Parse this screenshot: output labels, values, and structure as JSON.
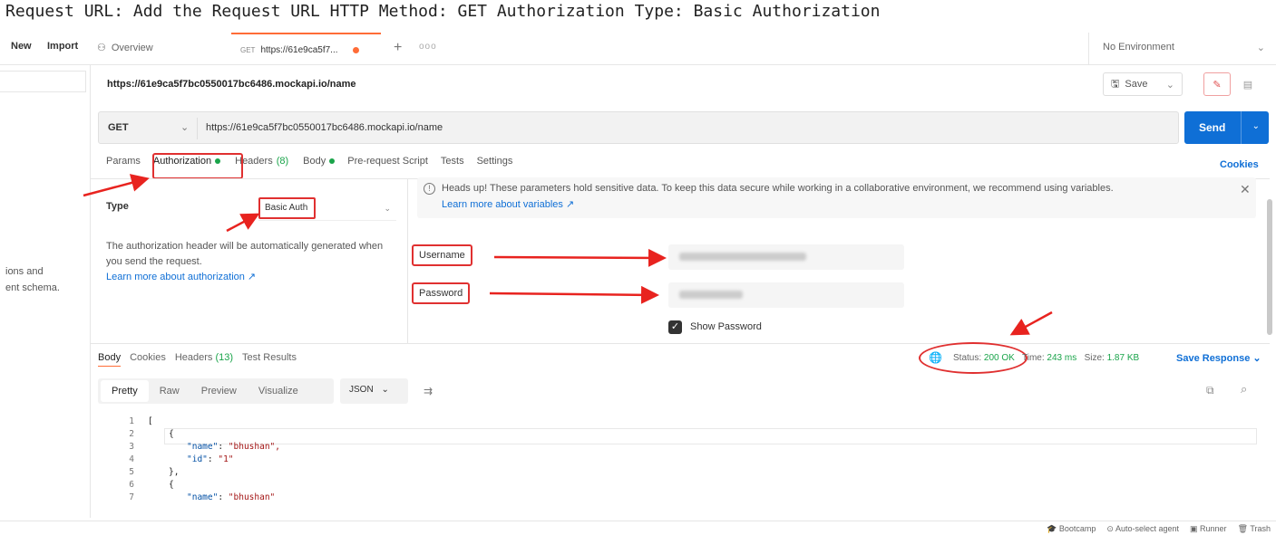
{
  "caption": "Request URL: Add the Request URL HTTP Method: GET Authorization Type: Basic Authorization",
  "topbar": {
    "new_label": "New",
    "import_label": "Import",
    "overview_label": "Overview",
    "active_tab_method": "GET",
    "active_tab_label": "https://61e9ca5f7...",
    "more_label": "ooo",
    "environment": "No Environment"
  },
  "sidebar": {
    "partial_text_1": "ions and",
    "partial_text_2": "ent schema."
  },
  "request": {
    "title": "https://61e9ca5f7bc0550017bc6486.mockapi.io/name",
    "save_label": "Save",
    "method": "GET",
    "url": "https://61e9ca5f7bc0550017bc6486.mockapi.io/name",
    "send_label": "Send"
  },
  "req_tabs": {
    "params": "Params",
    "authorization": "Authorization",
    "headers": "Headers",
    "headers_count": "(8)",
    "body": "Body",
    "pre_request": "Pre-request Script",
    "tests": "Tests",
    "settings": "Settings",
    "cookies": "Cookies"
  },
  "auth": {
    "type_label": "Type",
    "type_value": "Basic Auth",
    "desc": "The authorization header will be automatically generated when you send the request.",
    "learn_more": "Learn more about authorization ↗",
    "notice": "Heads up! These parameters hold sensitive data. To keep this data secure while working in a collaborative environment, we recommend using variables.",
    "notice_link": "Learn more about variables ↗",
    "username_label": "Username",
    "password_label": "Password",
    "show_password": "Show Password"
  },
  "response": {
    "body_tab": "Body",
    "cookies_tab": "Cookies",
    "headers_tab": "Headers",
    "headers_count": "(13)",
    "test_results_tab": "Test Results",
    "status_label": "Status:",
    "status_value": "200 OK",
    "time_label": "Time:",
    "time_value": "243 ms",
    "size_label": "Size:",
    "size_value": "1.87 KB",
    "save_response": "Save Response",
    "formats": [
      "Pretty",
      "Raw",
      "Preview",
      "Visualize"
    ],
    "json_label": "JSON"
  },
  "code_lines": [
    {
      "n": "1",
      "text": "["
    },
    {
      "n": "2",
      "text": "{"
    },
    {
      "n": "3",
      "key": "\"name\"",
      "val": "\"bhushan\","
    },
    {
      "n": "4",
      "key": "\"id\"",
      "val": "\"1\""
    },
    {
      "n": "5",
      "text": "},"
    },
    {
      "n": "6",
      "text": "{"
    },
    {
      "n": "7",
      "key": "\"name\"",
      "val": "\"bhushan\""
    }
  ],
  "footer": {
    "bootcamp": "Bootcamp",
    "auto_select": "Auto-select agent",
    "runner": "Runner",
    "trash": "Trash"
  },
  "colors": {
    "accent": "#ff6c37",
    "send_blue": "#0f6fd6",
    "annotation_red": "#e03030",
    "status_green": "#1aa44a"
  }
}
